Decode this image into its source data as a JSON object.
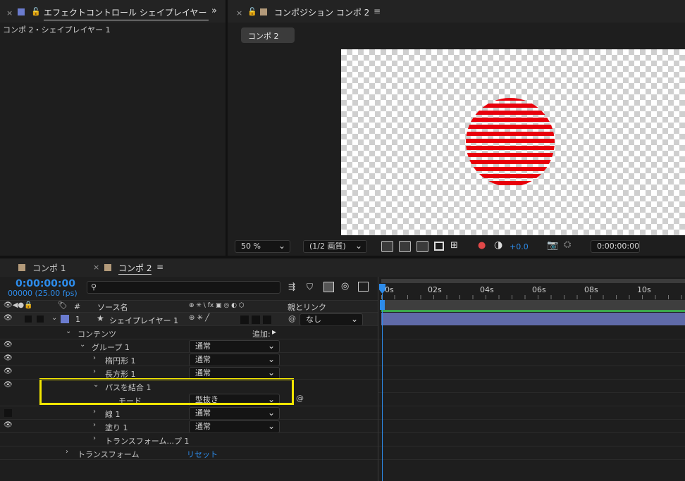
{
  "effects_panel": {
    "tab_title": "エフェクトコントロール シェイプレイヤー",
    "subtitle": "コンポ 2・シェイプレイヤー 1"
  },
  "comp_panel": {
    "tab_title": "コンポジション コンポ 2",
    "comp_button": "コンポ 2",
    "zoom": "50 %",
    "resolution": "(1/2 画質)",
    "exposure": "+0.0",
    "timecode": "0:00:00:00"
  },
  "timeline": {
    "tabs": [
      {
        "label": "コンポ 1"
      },
      {
        "label": "コンポ 2"
      }
    ],
    "timecode": "0:00:00:00",
    "frame_info": "00000 (25.00 fps)",
    "search_placeholder": "",
    "col_number": "#",
    "col_source": "ソース名",
    "col_switches": "⊕ ✳ \\ fx ▣ ◎ ◐ ⬡",
    "col_parent": "親とリンク",
    "ruler_ticks": [
      "0s",
      "02s",
      "04s",
      "06s",
      "08s",
      "10s"
    ],
    "layer": {
      "index": "1",
      "name": "シェイプレイヤー 1",
      "parent": "なし"
    },
    "add_label": "追加:",
    "rows": [
      {
        "label": "コンテンツ"
      },
      {
        "label": "グループ 1",
        "mode": "通常"
      },
      {
        "label": "楕円形 1",
        "mode": "通常"
      },
      {
        "label": "長方形 1",
        "mode": "通常"
      },
      {
        "label": "パスを結合 1"
      },
      {
        "label": "モード",
        "mode": "型抜き"
      },
      {
        "label": "線 1",
        "mode": "通常"
      },
      {
        "label": "塗り 1",
        "mode": "通常"
      },
      {
        "label": "トランスフォーム...プ 1"
      },
      {
        "label": "トランスフォーム",
        "action": "リセット"
      }
    ]
  },
  "colors": {
    "accent_blue": "#2d8ceb",
    "highlight_yellow": "#f2e600",
    "shape_red": "#e8000b",
    "layer_bar": "#5f6aa8"
  }
}
